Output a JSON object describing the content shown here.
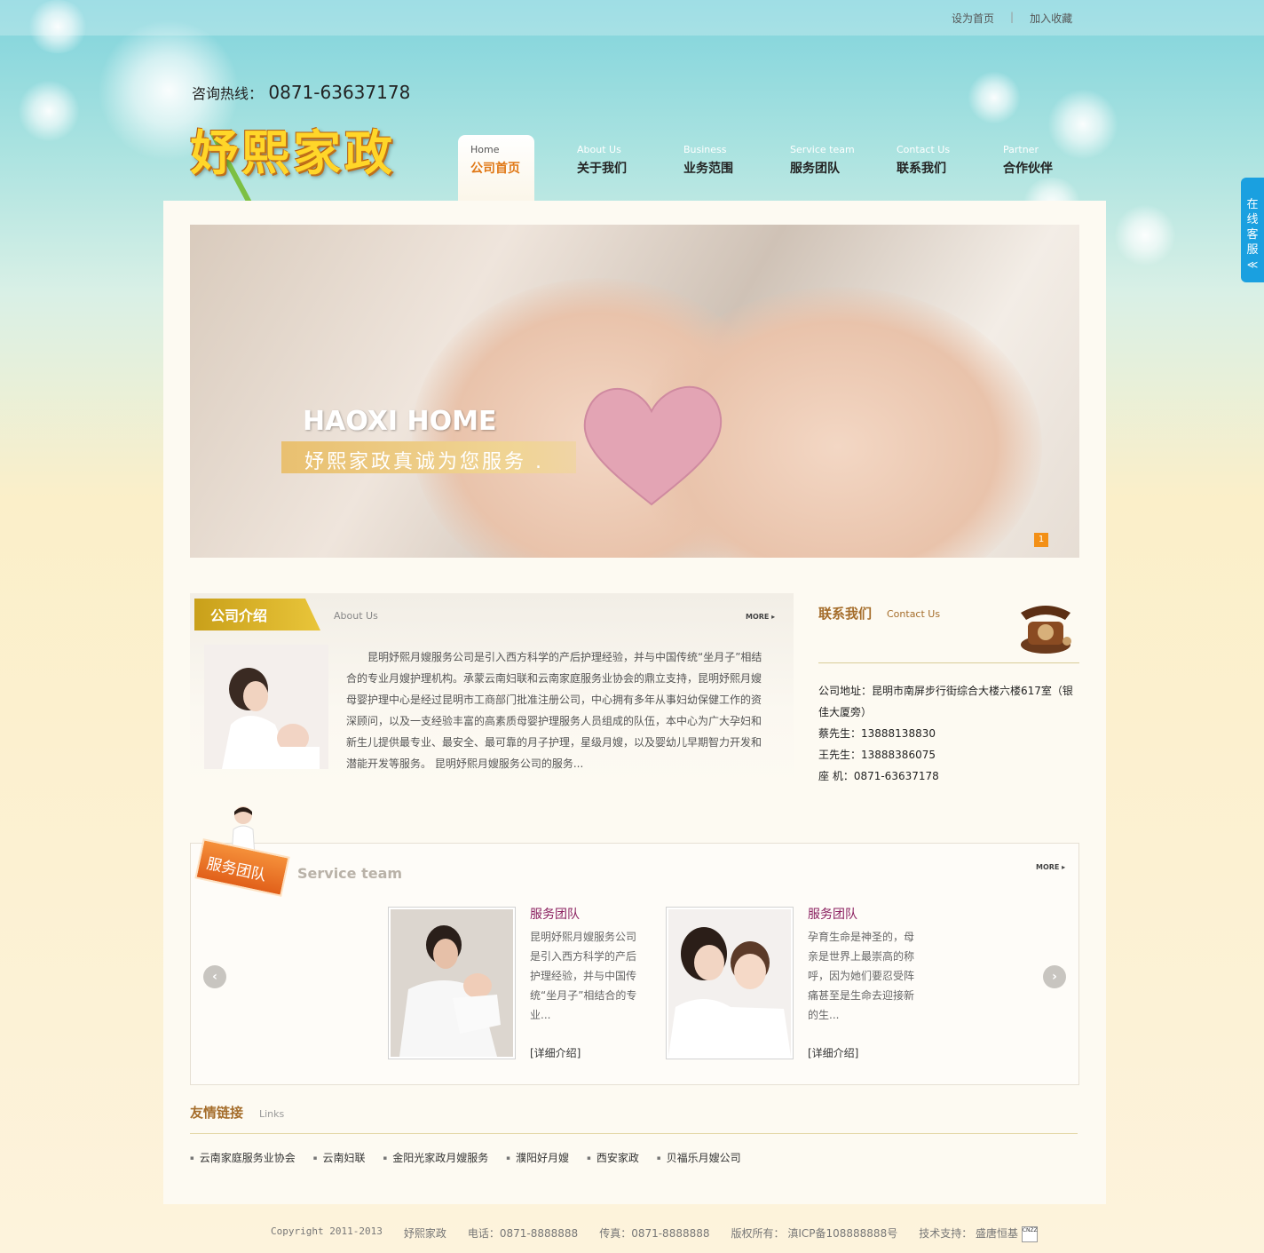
{
  "toplinks": {
    "set_home": "设为首页",
    "separator": "|",
    "bookmark": "加入收藏"
  },
  "hotline": {
    "label": "咨询热线：",
    "number": "0871-63637178"
  },
  "logo": "妤熙家政",
  "nav": [
    {
      "en": "Home",
      "cn": "公司首页"
    },
    {
      "en": "About Us",
      "cn": "关于我们"
    },
    {
      "en": "Business",
      "cn": "业务范围"
    },
    {
      "en": "Service team",
      "cn": "服务团队"
    },
    {
      "en": "Contact Us",
      "cn": "联系我们"
    },
    {
      "en": "Partner",
      "cn": "合作伙伴"
    }
  ],
  "side_service": {
    "text": "在线客服",
    "chevron": "≪"
  },
  "banner": {
    "title": "HAOXI HOME",
    "slogan": "妤熙家政真诚为您服务 .",
    "page": "1"
  },
  "about": {
    "title": "公司介绍",
    "en": "About Us",
    "more": "MORE ▸",
    "text": "昆明妤熙月嫂服务公司是引入西方科学的产后护理经验，并与中国传统“坐月子”相结合的专业月嫂护理机构。承蒙云南妇联和云南家庭服务业协会的鼎立支持，昆明妤熙月嫂母婴护理中心是经过昆明市工商部门批准注册公司，中心拥有多年从事妇幼保健工作的资深顾问，以及一支经验丰富的高素质母婴护理服务人员组成的队伍，本中心为广大孕妇和新生儿提供最专业、最安全、最可靠的月子护理，星级月嫂，以及婴幼儿早期智力开发和潜能开发等服务。 昆明妤熙月嫂服务公司的服务..."
  },
  "contact": {
    "title": "联系我们",
    "en": "Contact Us",
    "address": "公司地址：昆明市南屏步行街综合大楼六楼617室（银佳大厦旁）",
    "person1": "蔡先生：13888138830",
    "person2": "王先生：13888386075",
    "landline": "座 机：0871-63637178"
  },
  "service": {
    "badge": "服务团队",
    "en": "Service team",
    "more": "MORE ▸",
    "prev": "‹",
    "next": "›",
    "cards": [
      {
        "title": "服务团队",
        "desc": "昆明妤熙月嫂服务公司是引入西方科学的产后护理经验，并与中国传统“坐月子”相结合的专业...",
        "link": "[详细介绍]"
      },
      {
        "title": "服务团队",
        "desc": "孕育生命是神圣的，母亲是世界上最崇高的称呼，因为她们要忍受阵痛甚至是生命去迎接新的生...",
        "link": "[详细介绍]"
      }
    ]
  },
  "links": {
    "title": "友情链接",
    "en": "Links",
    "items": [
      "云南家庭服务业协会",
      "云南妇联",
      "金阳光家政月嫂服务",
      "濮阳好月嫂",
      "西安家政",
      "贝福乐月嫂公司"
    ]
  },
  "footer": {
    "copyright": "Copyright 2011-2013",
    "company": "妤熙家政",
    "phone": "电话：0871-8888888",
    "fax": "传真：0871-8888888",
    "icp": "版权所有： 滇ICP备108888888号",
    "support": "技术支持： 盛唐恒基",
    "cnzz": "CNZZ"
  },
  "colors": {
    "nav_active": "#e07816",
    "side_tab": "#1aa0e0",
    "accent_brown": "#a56d2b",
    "card_title": "#8a1f5f",
    "badge_orange": "#e1601a"
  }
}
